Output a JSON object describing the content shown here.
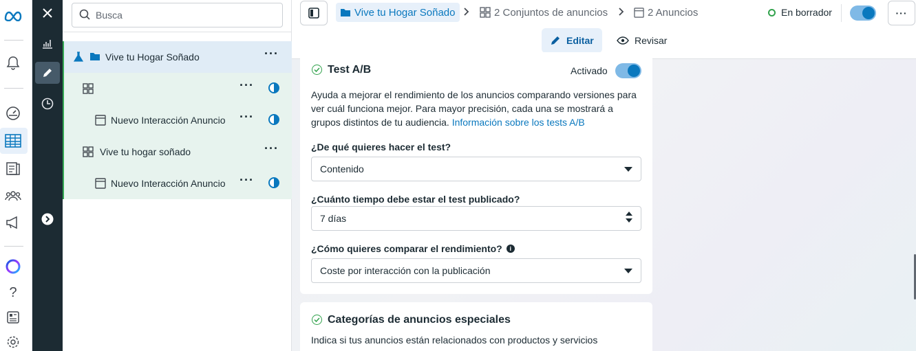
{
  "search": {
    "placeholder": "Busca"
  },
  "tree": {
    "campaign": "Vive tu Hogar Soñado",
    "adset1": "",
    "ad1": "Nuevo Interacción Anuncio",
    "adset2": "Vive tu hogar soñado",
    "ad2": "Nuevo Interacción Anuncio"
  },
  "breadcrumb": {
    "campaign": "Vive tu Hogar Soñado",
    "adsets": "2 Conjuntos de anuncios",
    "ads": "2 Anuncios"
  },
  "status": "En borrador",
  "tabs": {
    "edit": "Editar",
    "review": "Revisar"
  },
  "ab_test": {
    "title": "Test A/B",
    "toggle_label": "Activado",
    "description": "Ayuda a mejorar el rendimiento de los anuncios comparando versiones para ver cuál funciona mejor. Para mayor precisión, cada una se mostrará a grupos distintos de tu audiencia. ",
    "link": "Información sobre los tests A/B",
    "q1": "¿De qué quieres hacer el test?",
    "q1_value": "Contenido",
    "q2": "¿Cuánto tiempo debe estar el test publicado?",
    "q2_value": "7 días",
    "q3": "¿Cómo quieres comparar el rendimiento?",
    "q3_value": "Coste por interacción con la publicación"
  },
  "special": {
    "title": "Categorías de anuncios especiales",
    "description": "Indica si tus anuncios están relacionados con productos y servicios"
  },
  "colors": {
    "accent": "#0a78be",
    "success": "#31a24c",
    "dark_rail": "#1c2b33"
  }
}
